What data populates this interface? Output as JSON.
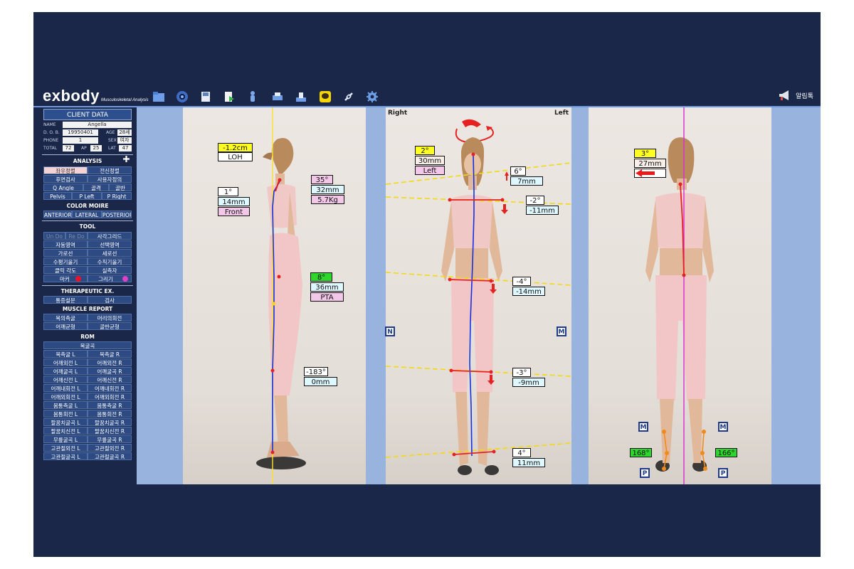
{
  "app": {
    "logo": "exbody",
    "tagline": "Musculoskeletal Analysis",
    "alarm_label": "알림톡"
  },
  "client": {
    "title": "CLIENT DATA",
    "name_label": "NAME",
    "name": "Angella",
    "dob_label": "D. O. B.",
    "dob": "19950401",
    "age_label": "AGE",
    "age": "28세",
    "phone_label": "PHONE",
    "phone": "1",
    "sex_label": "SEX",
    "sex": "여자",
    "total_label": "TOTAL",
    "total": "72",
    "ap_label": "AP",
    "ap": "25",
    "lat_label": "LAT",
    "lat": "47"
  },
  "analysis": {
    "title": "ANALYSIS",
    "add_icon": "plus-icon",
    "buttons": [
      "좌우정렬",
      "전신정렬",
      "후면검사",
      "사용자정의",
      "Q Angle",
      "골격",
      "골반",
      "Pelvis",
      "P Left",
      "P Right"
    ]
  },
  "color_moire": {
    "title": "COLOR MOIRE",
    "buttons": [
      "ANTERIOR",
      "LATERAL",
      "POSTERIOR"
    ]
  },
  "tool": {
    "title": "TOOL",
    "buttons": [
      "Un Do",
      "Re Do",
      "사각그리드",
      "자동영역",
      "선택영역",
      "가로선",
      "세로선",
      "수평기울기",
      "수직기울기",
      "클릭 각도",
      "실측자",
      "마커",
      "그리기"
    ]
  },
  "therapeutic": {
    "title": "THERAPEUTIC EX.",
    "buttons": [
      "통증설문",
      "검사"
    ]
  },
  "muscle_report": {
    "title": "MUSCLE REPORT",
    "buttons": [
      "목의측굴",
      "머리의회전",
      "어깨균형",
      "골반균형"
    ]
  },
  "rom": {
    "title": "ROM",
    "sub": "목굴곡",
    "rows": [
      [
        "목측굴 L",
        "목측굴 R"
      ],
      [
        "어깨외전 L",
        "어깨외전 R"
      ],
      [
        "어깨굴곡 L",
        "어깨굴곡 R"
      ],
      [
        "어깨신전 L",
        "어깨신전 R"
      ],
      [
        "어깨내회전 L",
        "어깨내회전 R"
      ],
      [
        "어깨외회전 L",
        "어깨외회전 R"
      ],
      [
        "몸통측굴 L",
        "몸통측굴 R"
      ],
      [
        "몸통회전 L",
        "몸통회전 R"
      ],
      [
        "팔꿈치굴곡 L",
        "팔꿈치굴곡 R"
      ],
      [
        "팔꿈치신전 L",
        "팔꿈치신전 R"
      ],
      [
        "무릎굴곡 L",
        "무릎굴곡 R"
      ],
      [
        "고관절외전 L",
        "고관절외전 R"
      ],
      [
        "고관절굴곡 L",
        "고관절굴곡 R"
      ]
    ]
  },
  "toolbar_icons": [
    "folder-icon",
    "camera-icon",
    "save-icon",
    "export-icon",
    "figure-icon",
    "print-icon",
    "scan-icon",
    "kakao-chat-icon",
    "link-icon",
    "settings-icon"
  ],
  "lateral": {
    "loh_value": "-1.2cm",
    "loh_label": "LOH",
    "head_angle": "1°",
    "head_mm": "14mm",
    "head_dir": "Front",
    "neck_angle": "35°",
    "neck_mm": "32mm",
    "neck_load": "5.7Kg",
    "pelvis_angle": "8°",
    "pelvis_mm": "36mm",
    "pelvis_label": "PTA",
    "knee_angle": "-183°",
    "knee_mm": "0mm"
  },
  "anterior": {
    "right_label": "Right",
    "left_label": "Left",
    "head_angle": "2°",
    "head_mm": "30mm",
    "head_dir": "Left",
    "ear_angle": "6°",
    "ear_mm": "7mm",
    "shoulder_angle": "-2°",
    "shoulder_mm": "-11mm",
    "pelvis_angle": "-4°",
    "pelvis_mm": "-14mm",
    "knee_angle": "-3°",
    "knee_mm": "-9mm",
    "ankle_angle": "4°",
    "ankle_mm": "11mm",
    "n_label": "N",
    "m_label": "M"
  },
  "posterior": {
    "angle": "3°",
    "mm": "27mm",
    "arrow_icon": "arrow-left-icon",
    "left_heel_angle": "168°",
    "right_heel_angle": "166°",
    "m_label": "M",
    "p_label": "P"
  }
}
